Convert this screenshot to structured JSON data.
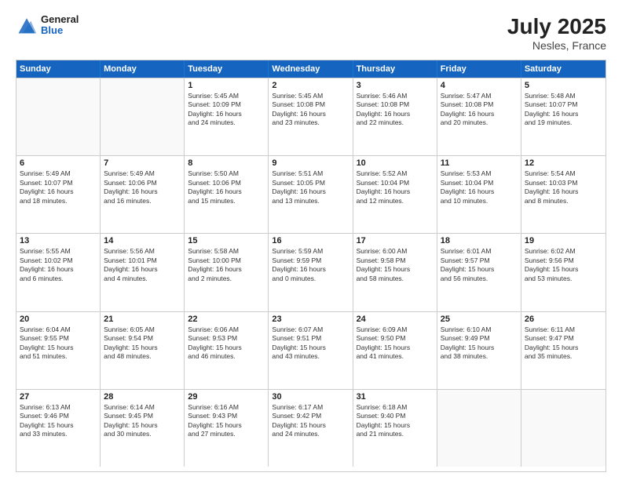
{
  "header": {
    "logo": {
      "general": "General",
      "blue": "Blue"
    },
    "title": "July 2025",
    "location": "Nesles, France"
  },
  "weekdays": [
    "Sunday",
    "Monday",
    "Tuesday",
    "Wednesday",
    "Thursday",
    "Friday",
    "Saturday"
  ],
  "weeks": [
    [
      {
        "day": "",
        "empty": true
      },
      {
        "day": "",
        "empty": true
      },
      {
        "day": "1",
        "line1": "Sunrise: 5:45 AM",
        "line2": "Sunset: 10:09 PM",
        "line3": "Daylight: 16 hours",
        "line4": "and 24 minutes."
      },
      {
        "day": "2",
        "line1": "Sunrise: 5:45 AM",
        "line2": "Sunset: 10:08 PM",
        "line3": "Daylight: 16 hours",
        "line4": "and 23 minutes."
      },
      {
        "day": "3",
        "line1": "Sunrise: 5:46 AM",
        "line2": "Sunset: 10:08 PM",
        "line3": "Daylight: 16 hours",
        "line4": "and 22 minutes."
      },
      {
        "day": "4",
        "line1": "Sunrise: 5:47 AM",
        "line2": "Sunset: 10:08 PM",
        "line3": "Daylight: 16 hours",
        "line4": "and 20 minutes."
      },
      {
        "day": "5",
        "line1": "Sunrise: 5:48 AM",
        "line2": "Sunset: 10:07 PM",
        "line3": "Daylight: 16 hours",
        "line4": "and 19 minutes."
      }
    ],
    [
      {
        "day": "6",
        "line1": "Sunrise: 5:49 AM",
        "line2": "Sunset: 10:07 PM",
        "line3": "Daylight: 16 hours",
        "line4": "and 18 minutes."
      },
      {
        "day": "7",
        "line1": "Sunrise: 5:49 AM",
        "line2": "Sunset: 10:06 PM",
        "line3": "Daylight: 16 hours",
        "line4": "and 16 minutes."
      },
      {
        "day": "8",
        "line1": "Sunrise: 5:50 AM",
        "line2": "Sunset: 10:06 PM",
        "line3": "Daylight: 16 hours",
        "line4": "and 15 minutes."
      },
      {
        "day": "9",
        "line1": "Sunrise: 5:51 AM",
        "line2": "Sunset: 10:05 PM",
        "line3": "Daylight: 16 hours",
        "line4": "and 13 minutes."
      },
      {
        "day": "10",
        "line1": "Sunrise: 5:52 AM",
        "line2": "Sunset: 10:04 PM",
        "line3": "Daylight: 16 hours",
        "line4": "and 12 minutes."
      },
      {
        "day": "11",
        "line1": "Sunrise: 5:53 AM",
        "line2": "Sunset: 10:04 PM",
        "line3": "Daylight: 16 hours",
        "line4": "and 10 minutes."
      },
      {
        "day": "12",
        "line1": "Sunrise: 5:54 AM",
        "line2": "Sunset: 10:03 PM",
        "line3": "Daylight: 16 hours",
        "line4": "and 8 minutes."
      }
    ],
    [
      {
        "day": "13",
        "line1": "Sunrise: 5:55 AM",
        "line2": "Sunset: 10:02 PM",
        "line3": "Daylight: 16 hours",
        "line4": "and 6 minutes."
      },
      {
        "day": "14",
        "line1": "Sunrise: 5:56 AM",
        "line2": "Sunset: 10:01 PM",
        "line3": "Daylight: 16 hours",
        "line4": "and 4 minutes."
      },
      {
        "day": "15",
        "line1": "Sunrise: 5:58 AM",
        "line2": "Sunset: 10:00 PM",
        "line3": "Daylight: 16 hours",
        "line4": "and 2 minutes."
      },
      {
        "day": "16",
        "line1": "Sunrise: 5:59 AM",
        "line2": "Sunset: 9:59 PM",
        "line3": "Daylight: 16 hours",
        "line4": "and 0 minutes."
      },
      {
        "day": "17",
        "line1": "Sunrise: 6:00 AM",
        "line2": "Sunset: 9:58 PM",
        "line3": "Daylight: 15 hours",
        "line4": "and 58 minutes."
      },
      {
        "day": "18",
        "line1": "Sunrise: 6:01 AM",
        "line2": "Sunset: 9:57 PM",
        "line3": "Daylight: 15 hours",
        "line4": "and 56 minutes."
      },
      {
        "day": "19",
        "line1": "Sunrise: 6:02 AM",
        "line2": "Sunset: 9:56 PM",
        "line3": "Daylight: 15 hours",
        "line4": "and 53 minutes."
      }
    ],
    [
      {
        "day": "20",
        "line1": "Sunrise: 6:04 AM",
        "line2": "Sunset: 9:55 PM",
        "line3": "Daylight: 15 hours",
        "line4": "and 51 minutes."
      },
      {
        "day": "21",
        "line1": "Sunrise: 6:05 AM",
        "line2": "Sunset: 9:54 PM",
        "line3": "Daylight: 15 hours",
        "line4": "and 48 minutes."
      },
      {
        "day": "22",
        "line1": "Sunrise: 6:06 AM",
        "line2": "Sunset: 9:53 PM",
        "line3": "Daylight: 15 hours",
        "line4": "and 46 minutes."
      },
      {
        "day": "23",
        "line1": "Sunrise: 6:07 AM",
        "line2": "Sunset: 9:51 PM",
        "line3": "Daylight: 15 hours",
        "line4": "and 43 minutes."
      },
      {
        "day": "24",
        "line1": "Sunrise: 6:09 AM",
        "line2": "Sunset: 9:50 PM",
        "line3": "Daylight: 15 hours",
        "line4": "and 41 minutes."
      },
      {
        "day": "25",
        "line1": "Sunrise: 6:10 AM",
        "line2": "Sunset: 9:49 PM",
        "line3": "Daylight: 15 hours",
        "line4": "and 38 minutes."
      },
      {
        "day": "26",
        "line1": "Sunrise: 6:11 AM",
        "line2": "Sunset: 9:47 PM",
        "line3": "Daylight: 15 hours",
        "line4": "and 35 minutes."
      }
    ],
    [
      {
        "day": "27",
        "line1": "Sunrise: 6:13 AM",
        "line2": "Sunset: 9:46 PM",
        "line3": "Daylight: 15 hours",
        "line4": "and 33 minutes."
      },
      {
        "day": "28",
        "line1": "Sunrise: 6:14 AM",
        "line2": "Sunset: 9:45 PM",
        "line3": "Daylight: 15 hours",
        "line4": "and 30 minutes."
      },
      {
        "day": "29",
        "line1": "Sunrise: 6:16 AM",
        "line2": "Sunset: 9:43 PM",
        "line3": "Daylight: 15 hours",
        "line4": "and 27 minutes."
      },
      {
        "day": "30",
        "line1": "Sunrise: 6:17 AM",
        "line2": "Sunset: 9:42 PM",
        "line3": "Daylight: 15 hours",
        "line4": "and 24 minutes."
      },
      {
        "day": "31",
        "line1": "Sunrise: 6:18 AM",
        "line2": "Sunset: 9:40 PM",
        "line3": "Daylight: 15 hours",
        "line4": "and 21 minutes."
      },
      {
        "day": "",
        "empty": true
      },
      {
        "day": "",
        "empty": true
      }
    ]
  ]
}
